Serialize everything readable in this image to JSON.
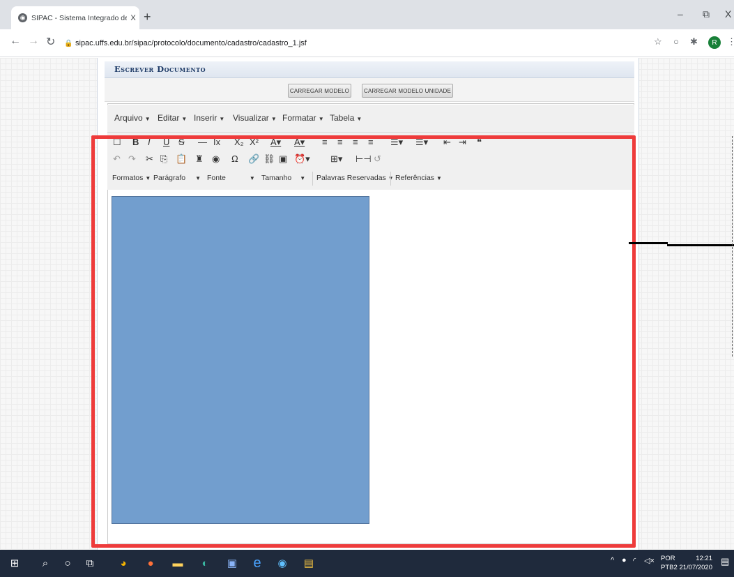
{
  "browser": {
    "tab_title": "SIPAC - Sistema Integrado de Pa",
    "tab_close": "X",
    "new_tab": "+",
    "url": "sipac.uffs.edu.br/sipac/protocolo/documento/cadastro/cadastro_1.jsf",
    "window_controls": {
      "minimize": "–",
      "restore": "⧉",
      "close": "X"
    },
    "profile_initial": "R"
  },
  "page": {
    "section_title": "Escrever Documento",
    "buttons": {
      "load_model": "CARREGAR MODELO",
      "load_unit_model": "CARREGAR MODELO UNIDADE"
    }
  },
  "editor": {
    "menus": [
      "Arquivo",
      "Editar",
      "Inserir",
      "Visualizar",
      "Formatar",
      "Tabela"
    ],
    "format_dropdowns": [
      "Formatos",
      "Parágrafo",
      "Fonte",
      "Tamanho",
      "Palavras Reservadas",
      "Referências"
    ],
    "content_block_color": "#729ece"
  },
  "annotation": {
    "frame_color": "#ee3b3b"
  },
  "taskbar": {
    "lang_top": "POR",
    "lang_bottom": "PTB2",
    "time": "12:21",
    "date": "21/07/2020"
  }
}
